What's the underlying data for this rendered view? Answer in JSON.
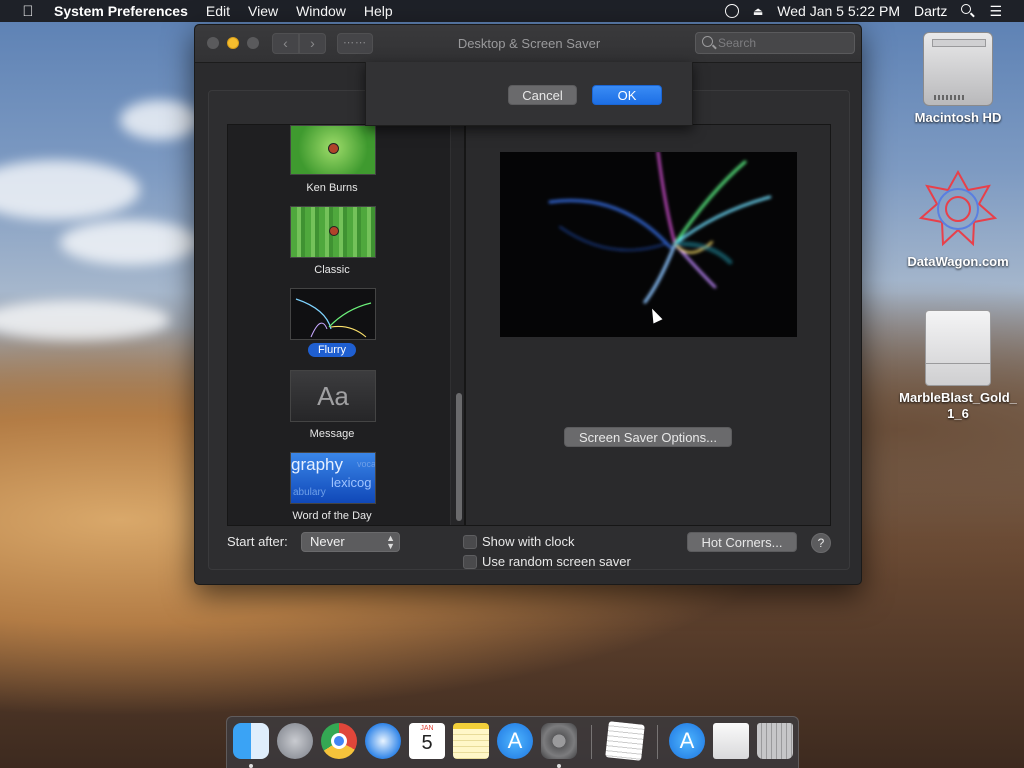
{
  "menubar": {
    "app_name": "System Preferences",
    "menus": [
      "Edit",
      "View",
      "Window",
      "Help"
    ],
    "datetime": "Wed Jan 5  5:22 PM",
    "user": "Dartz"
  },
  "window": {
    "title": "Desktop & Screen Saver",
    "search_placeholder": "Search"
  },
  "sheet": {
    "cancel_label": "Cancel",
    "ok_label": "OK"
  },
  "screensavers": [
    {
      "name": "Ken Burns",
      "selected": false
    },
    {
      "name": "Classic",
      "selected": false
    },
    {
      "name": "Flurry",
      "selected": true
    },
    {
      "name": "Message",
      "selected": false,
      "thumb_text": "Aa"
    },
    {
      "name": "Word of the Day",
      "selected": false,
      "thumb_words": [
        "graphy",
        "lexicog",
        "abulary",
        "voca"
      ]
    }
  ],
  "preview": {
    "options_label": "Screen Saver Options..."
  },
  "bottom": {
    "start_after_label": "Start after:",
    "start_after_value": "Never",
    "show_clock_label": "Show with clock",
    "show_clock_checked": false,
    "random_label": "Use random screen saver",
    "random_checked": false,
    "hot_corners_label": "Hot Corners...",
    "help_label": "?"
  },
  "desktop_icons": [
    {
      "label": "Macintosh HD",
      "icon": "hard-drive-icon"
    },
    {
      "label": "DataWagon.com",
      "icon": "datawagon-logo-icon"
    },
    {
      "label": "MarbleBlast_Gold_1_6",
      "icon": "disk-image-icon"
    }
  ],
  "dock": {
    "calendar_month": "JAN",
    "calendar_day": "5",
    "apps": [
      "finder-icon",
      "launchpad-icon",
      "chrome-icon",
      "safari-icon",
      "calendar-icon",
      "notes-icon",
      "app-store-icon",
      "system-preferences-icon",
      "textedit-icon",
      "app-store-folder-icon",
      "document-icon",
      "trash-icon"
    ]
  },
  "colors": {
    "accent": "#1f6fe5",
    "window_bg": "#2b2b2d",
    "traffic_minimize": "#f5bd2e"
  }
}
